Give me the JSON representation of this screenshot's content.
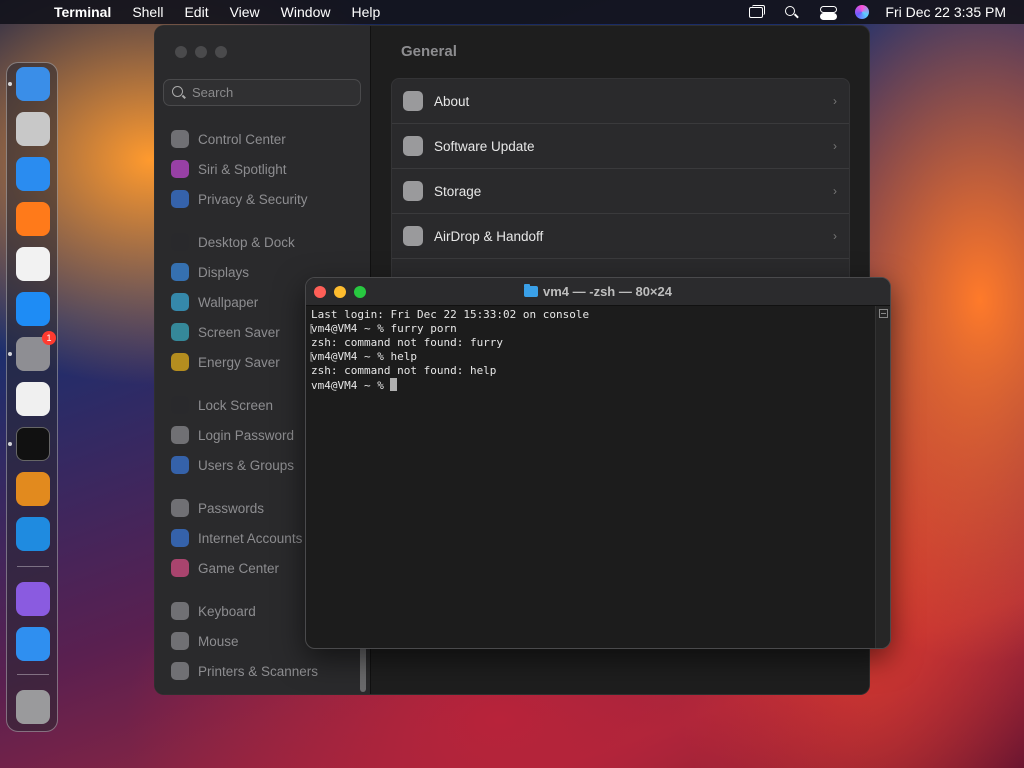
{
  "menubar": {
    "app_name": "Terminal",
    "menus": [
      "Shell",
      "Edit",
      "View",
      "Window",
      "Help"
    ],
    "clock": "Fri Dec 22  3:35 PM"
  },
  "dock": {
    "apps": [
      {
        "name": "finder-icon",
        "color": "#3a8ee8"
      },
      {
        "name": "launchpad-icon",
        "color": "#c8c8c8"
      },
      {
        "name": "safari-icon",
        "color": "#2a8cf0"
      },
      {
        "name": "firefox-icon",
        "color": "#ff7a1a"
      },
      {
        "name": "chrome-icon",
        "color": "#f2f2f2"
      },
      {
        "name": "app-store-icon",
        "color": "#1e8cf5"
      },
      {
        "name": "system-settings-icon",
        "color": "#8e8e93",
        "badge": "1"
      },
      {
        "name": "textedit-icon",
        "color": "#f0f0f0"
      },
      {
        "name": "terminal-icon",
        "color": "#111111"
      },
      {
        "name": "garageband-icon",
        "color": "#e28a1e"
      },
      {
        "name": "vscode-icon",
        "color": "#1f8be0"
      },
      {
        "name": "visual-studio-icon",
        "color": "#8a5be0"
      },
      {
        "name": "weather-icon",
        "color": "#2f8ff0"
      },
      {
        "name": "trash-icon",
        "color": "#9a9a9c"
      }
    ]
  },
  "settings": {
    "search_placeholder": "Search",
    "title": "General",
    "sidebar": [
      {
        "label": "Control Center",
        "color": "#8e8e93"
      },
      {
        "label": "Siri & Spotlight",
        "color": "#c84ad8"
      },
      {
        "label": "Privacy & Security",
        "color": "#3a7ae0"
      },
      {
        "label": "Desktop & Dock",
        "color": "#2a2a2c"
      },
      {
        "label": "Displays",
        "color": "#3a8ee8"
      },
      {
        "label": "Wallpaper",
        "color": "#3ab0e0"
      },
      {
        "label": "Screen Saver",
        "color": "#3ab0c8"
      },
      {
        "label": "Energy Saver",
        "color": "#f0b81a"
      },
      {
        "label": "Lock Screen",
        "color": "#2a2a2c"
      },
      {
        "label": "Login Password",
        "color": "#8e8e93"
      },
      {
        "label": "Users & Groups",
        "color": "#3a7ae0"
      },
      {
        "label": "Passwords",
        "color": "#8e8e93"
      },
      {
        "label": "Internet Accounts",
        "color": "#3a7ae0"
      },
      {
        "label": "Game Center",
        "color": "#e0508a"
      },
      {
        "label": "Keyboard",
        "color": "#8e8e93"
      },
      {
        "label": "Mouse",
        "color": "#8e8e93"
      },
      {
        "label": "Printers & Scanners",
        "color": "#8e8e93"
      }
    ],
    "rows": [
      {
        "label": "About"
      },
      {
        "label": "Software Update"
      },
      {
        "label": "Storage"
      },
      {
        "label": "AirDrop & Handoff"
      }
    ]
  },
  "terminal": {
    "title": "vm4 — -zsh — 80×24",
    "lines": [
      "Last login: Fri Dec 22 15:33:02 on console",
      "vm4@VM4 ~ % furry porn",
      "zsh: command not found: furry",
      "vm4@VM4 ~ % help",
      "zsh: command not found: help",
      "vm4@VM4 ~ % "
    ]
  }
}
